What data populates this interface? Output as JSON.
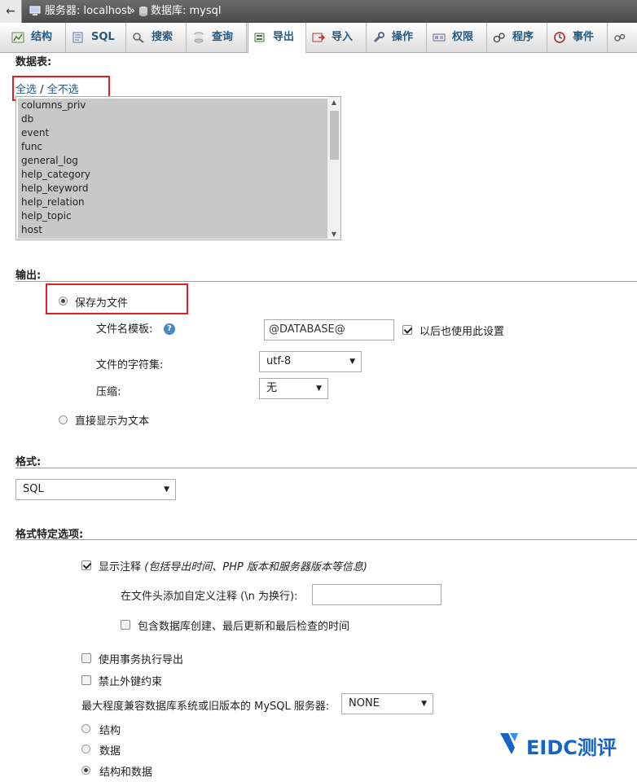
{
  "breadcrumb": {
    "back_glyph": "←",
    "server": "服务器: localhost",
    "separator": "»",
    "database": "数据库: mysql"
  },
  "tabs": [
    {
      "label": "结构",
      "icon": "structure-icon"
    },
    {
      "label": "SQL",
      "icon": "sql-icon"
    },
    {
      "label": "搜索",
      "icon": "search-icon"
    },
    {
      "label": "查询",
      "icon": "query-icon"
    },
    {
      "label": "导出",
      "icon": "export-icon",
      "active": true
    },
    {
      "label": "导入",
      "icon": "import-icon"
    },
    {
      "label": "操作",
      "icon": "wrench-icon"
    },
    {
      "label": "权限",
      "icon": "privileges-icon"
    },
    {
      "label": "程序",
      "icon": "routines-icon"
    },
    {
      "label": "事件",
      "icon": "clock-icon"
    }
  ],
  "tables_section": {
    "title": "数据表:",
    "select_all": "全选",
    "slash": "/",
    "unselect_all": "全不选",
    "items": [
      "columns_priv",
      "db",
      "event",
      "func",
      "general_log",
      "help_category",
      "help_keyword",
      "help_relation",
      "help_topic",
      "host"
    ]
  },
  "output_section": {
    "title": "输出:",
    "save_as_file": "保存为文件",
    "filename_template_label": "文件名模板:",
    "filename_template_value": "@DATABASE@",
    "remember_label": "以后也使用此设置",
    "charset_label": "文件的字符集:",
    "charset_value": "utf-8",
    "compression_label": "压缩:",
    "compression_value": "无",
    "show_as_text": "直接显示为文本"
  },
  "format_section": {
    "title": "格式:",
    "format_value": "SQL"
  },
  "format_options": {
    "title": "格式特定选项:",
    "show_comments": "显示注释",
    "show_comments_note": "(包括导出时间、PHP 版本和服务器版本等信息)",
    "custom_header_label": "在文件头添加自定义注释 (\\n 为换行):",
    "include_timestamps": "包含数据库创建、最后更新和最后检查的时间",
    "use_transaction": "使用事务执行导出",
    "disable_fk": "禁止外键约束",
    "compat_label": "最大程度兼容数据库系统或旧版本的 MySQL 服务器:",
    "compat_value": "NONE",
    "dump_structure": "结构",
    "dump_data": "数据",
    "dump_both": "结构和数据"
  },
  "watermark": {
    "text": "EIDC测评"
  },
  "colors": {
    "link": "#235a81",
    "highlight_box": "#e02020",
    "watermark": "#1565c8"
  }
}
